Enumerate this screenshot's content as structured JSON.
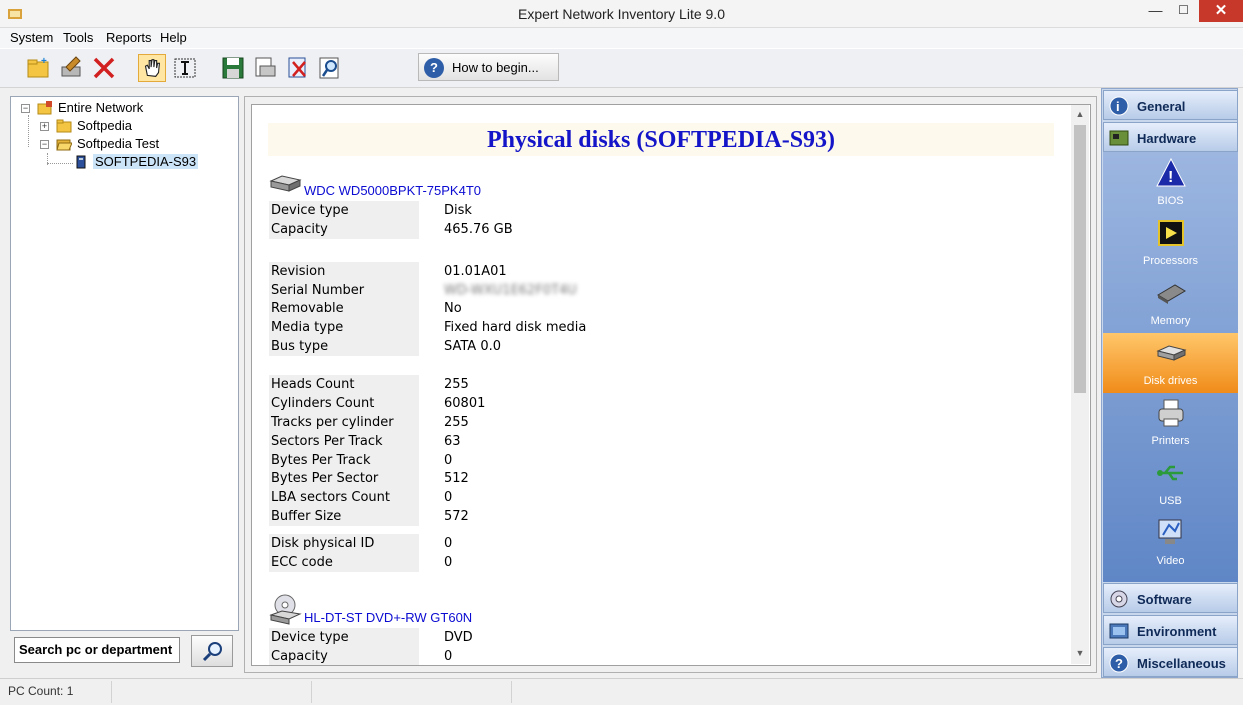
{
  "window": {
    "title": "Expert Network Inventory Lite 9.0",
    "close_glyph": "✕",
    "min_glyph": "—",
    "max_glyph": "☐"
  },
  "menu": [
    "System",
    "Tools",
    "Reports",
    "Help"
  ],
  "toolbar": {
    "howto_label": "How to begin..."
  },
  "tree": {
    "root": "Entire Network",
    "children": [
      "Softpedia",
      "Softpedia Test"
    ],
    "selected_pc": "SOFTPEDIA-S93"
  },
  "search": {
    "label": "Search pc or department"
  },
  "content": {
    "heading": "Physical disks (SOFTPEDIA-S93)",
    "disks": [
      {
        "name": "WDC WD5000BPKT-75PK4T0",
        "groups": [
          [
            {
              "label": "Device type",
              "value": "Disk"
            },
            {
              "label": "Capacity",
              "value": "465.76 GB"
            }
          ],
          [
            {
              "label": "Revision",
              "value": "01.01A01"
            },
            {
              "label": "Serial Number",
              "value": "WD-WXU1E62F0T4U"
            },
            {
              "label": "Removable",
              "value": "No"
            },
            {
              "label": "Media type",
              "value": "Fixed hard disk media"
            },
            {
              "label": "Bus type",
              "value": "SATA 0.0"
            }
          ],
          [
            {
              "label": "Heads Count",
              "value": "255"
            },
            {
              "label": "Cylinders Count",
              "value": "60801"
            },
            {
              "label": "Tracks per cylinder",
              "value": "255"
            },
            {
              "label": "Sectors Per Track",
              "value": "63"
            },
            {
              "label": "Bytes Per Track",
              "value": "0"
            },
            {
              "label": "Bytes Per Sector",
              "value": "512"
            },
            {
              "label": "LBA sectors Count",
              "value": "0"
            },
            {
              "label": "Buffer Size",
              "value": "572"
            }
          ],
          [
            {
              "label": "Disk physical ID",
              "value": "0"
            },
            {
              "label": "ECC code",
              "value": "0"
            }
          ]
        ]
      },
      {
        "name": "HL-DT-ST DVD+-RW GT60N",
        "groups": [
          [
            {
              "label": "Device type",
              "value": "DVD"
            },
            {
              "label": "Capacity",
              "value": "0"
            }
          ]
        ]
      }
    ]
  },
  "nav": {
    "sections_top": [
      "General",
      "Hardware"
    ],
    "hardware_items": [
      "BIOS",
      "Processors",
      "Memory",
      "Disk drives",
      "Printers",
      "USB",
      "Video"
    ],
    "selected_item": "Disk drives",
    "sections_bottom": [
      "Software",
      "Environment",
      "Miscellaneous"
    ]
  },
  "status": {
    "pc_count": "PC Count: 1"
  },
  "colors": {
    "heading": "#1414c8",
    "disk_name": "#0b0bd2",
    "nav_selected": "#f08c1a",
    "nav_bg": "#6f93cd"
  }
}
